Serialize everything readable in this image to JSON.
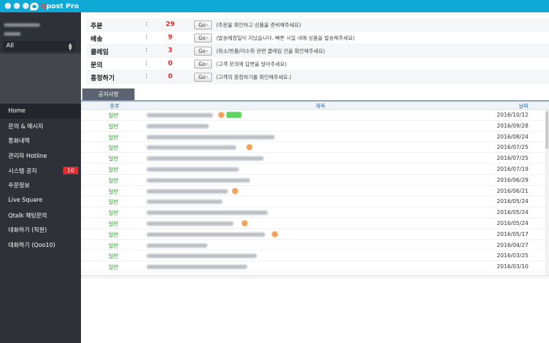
{
  "app": {
    "brand_prefix": "Q",
    "brand_rest": "post Pro",
    "title_bar_color": "#10a9d5"
  },
  "sidebar": {
    "store_select": {
      "value": "All"
    },
    "items": [
      {
        "label": "Home",
        "active": true
      },
      {
        "label": "문의 & 메시지"
      },
      {
        "label": "통화내역"
      },
      {
        "label": "관리자 Hotline"
      },
      {
        "label": "시스템 공지",
        "badge": "10"
      },
      {
        "label": "주문정보"
      },
      {
        "label": "Live Square"
      },
      {
        "label": "Qtalk 채팅문의"
      },
      {
        "label": "대화하기 (직원)"
      },
      {
        "label": "대화하기 (Qoo10)"
      }
    ]
  },
  "summary": {
    "colon": ":",
    "go_label": "Go",
    "rows": [
      {
        "label": "주문",
        "count": "29",
        "desc": "(주문을 확인하고 상품을 준비해주세요)"
      },
      {
        "label": "배송",
        "count": "9",
        "desc": "(발송예정일이 지났습니다. 빠른 시일 내에 상품을 발송해주세요)"
      },
      {
        "label": "클레임",
        "count": "3",
        "desc": "(취소/반품/미수취 관련 클레임 건을 확인해주세요)"
      },
      {
        "label": "문의",
        "count": "0",
        "desc": "(고객 문의에 답변을 달아주세요)"
      },
      {
        "label": "흥정하기",
        "count": "0",
        "desc": "(고객의 흥정하기를 확인해주세요.)"
      }
    ]
  },
  "notices": {
    "tab_label": "공지사항",
    "headers": {
      "category": "종류",
      "title": "제목",
      "date": "날짜"
    },
    "rows": [
      {
        "category": "일반",
        "date": "2016/10/12"
      },
      {
        "category": "일반",
        "date": "2016/09/28"
      },
      {
        "category": "일반",
        "date": "2016/08/24"
      },
      {
        "category": "일반",
        "date": "2016/07/25"
      },
      {
        "category": "일반",
        "date": "2016/07/25"
      },
      {
        "category": "일반",
        "date": "2016/07/19"
      },
      {
        "category": "일반",
        "date": "2016/06/29"
      },
      {
        "category": "일반",
        "date": "2016/06/21"
      },
      {
        "category": "일반",
        "date": "2016/05/24"
      },
      {
        "category": "일반",
        "date": "2016/05/24"
      },
      {
        "category": "일반",
        "date": "2016/05/24"
      },
      {
        "category": "일반",
        "date": "2016/05/17"
      },
      {
        "category": "일반",
        "date": "2016/04/27"
      },
      {
        "category": "일반",
        "date": "2016/03/25"
      },
      {
        "category": "일반",
        "date": "2016/03/10"
      }
    ]
  }
}
